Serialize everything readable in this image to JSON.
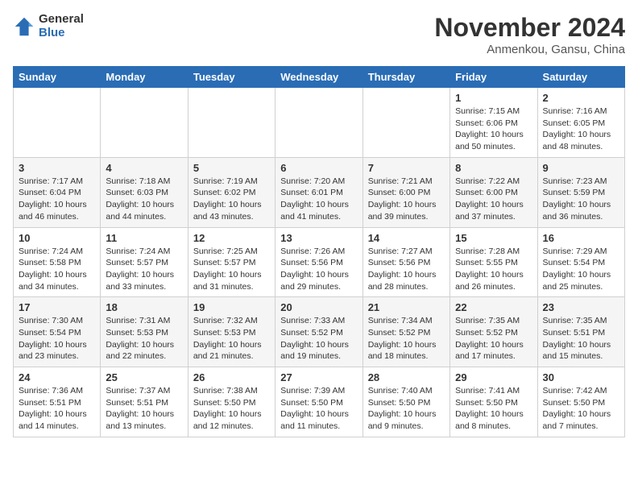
{
  "header": {
    "logo": {
      "general": "General",
      "blue": "Blue"
    },
    "title": "November 2024",
    "location": "Anmenkou, Gansu, China"
  },
  "days_of_week": [
    "Sunday",
    "Monday",
    "Tuesday",
    "Wednesday",
    "Thursday",
    "Friday",
    "Saturday"
  ],
  "weeks": [
    [
      {
        "day": "",
        "info": ""
      },
      {
        "day": "",
        "info": ""
      },
      {
        "day": "",
        "info": ""
      },
      {
        "day": "",
        "info": ""
      },
      {
        "day": "",
        "info": ""
      },
      {
        "day": "1",
        "info": "Sunrise: 7:15 AM\nSunset: 6:06 PM\nDaylight: 10 hours\nand 50 minutes."
      },
      {
        "day": "2",
        "info": "Sunrise: 7:16 AM\nSunset: 6:05 PM\nDaylight: 10 hours\nand 48 minutes."
      }
    ],
    [
      {
        "day": "3",
        "info": "Sunrise: 7:17 AM\nSunset: 6:04 PM\nDaylight: 10 hours\nand 46 minutes."
      },
      {
        "day": "4",
        "info": "Sunrise: 7:18 AM\nSunset: 6:03 PM\nDaylight: 10 hours\nand 44 minutes."
      },
      {
        "day": "5",
        "info": "Sunrise: 7:19 AM\nSunset: 6:02 PM\nDaylight: 10 hours\nand 43 minutes."
      },
      {
        "day": "6",
        "info": "Sunrise: 7:20 AM\nSunset: 6:01 PM\nDaylight: 10 hours\nand 41 minutes."
      },
      {
        "day": "7",
        "info": "Sunrise: 7:21 AM\nSunset: 6:00 PM\nDaylight: 10 hours\nand 39 minutes."
      },
      {
        "day": "8",
        "info": "Sunrise: 7:22 AM\nSunset: 6:00 PM\nDaylight: 10 hours\nand 37 minutes."
      },
      {
        "day": "9",
        "info": "Sunrise: 7:23 AM\nSunset: 5:59 PM\nDaylight: 10 hours\nand 36 minutes."
      }
    ],
    [
      {
        "day": "10",
        "info": "Sunrise: 7:24 AM\nSunset: 5:58 PM\nDaylight: 10 hours\nand 34 minutes."
      },
      {
        "day": "11",
        "info": "Sunrise: 7:24 AM\nSunset: 5:57 PM\nDaylight: 10 hours\nand 33 minutes."
      },
      {
        "day": "12",
        "info": "Sunrise: 7:25 AM\nSunset: 5:57 PM\nDaylight: 10 hours\nand 31 minutes."
      },
      {
        "day": "13",
        "info": "Sunrise: 7:26 AM\nSunset: 5:56 PM\nDaylight: 10 hours\nand 29 minutes."
      },
      {
        "day": "14",
        "info": "Sunrise: 7:27 AM\nSunset: 5:56 PM\nDaylight: 10 hours\nand 28 minutes."
      },
      {
        "day": "15",
        "info": "Sunrise: 7:28 AM\nSunset: 5:55 PM\nDaylight: 10 hours\nand 26 minutes."
      },
      {
        "day": "16",
        "info": "Sunrise: 7:29 AM\nSunset: 5:54 PM\nDaylight: 10 hours\nand 25 minutes."
      }
    ],
    [
      {
        "day": "17",
        "info": "Sunrise: 7:30 AM\nSunset: 5:54 PM\nDaylight: 10 hours\nand 23 minutes."
      },
      {
        "day": "18",
        "info": "Sunrise: 7:31 AM\nSunset: 5:53 PM\nDaylight: 10 hours\nand 22 minutes."
      },
      {
        "day": "19",
        "info": "Sunrise: 7:32 AM\nSunset: 5:53 PM\nDaylight: 10 hours\nand 21 minutes."
      },
      {
        "day": "20",
        "info": "Sunrise: 7:33 AM\nSunset: 5:52 PM\nDaylight: 10 hours\nand 19 minutes."
      },
      {
        "day": "21",
        "info": "Sunrise: 7:34 AM\nSunset: 5:52 PM\nDaylight: 10 hours\nand 18 minutes."
      },
      {
        "day": "22",
        "info": "Sunrise: 7:35 AM\nSunset: 5:52 PM\nDaylight: 10 hours\nand 17 minutes."
      },
      {
        "day": "23",
        "info": "Sunrise: 7:35 AM\nSunset: 5:51 PM\nDaylight: 10 hours\nand 15 minutes."
      }
    ],
    [
      {
        "day": "24",
        "info": "Sunrise: 7:36 AM\nSunset: 5:51 PM\nDaylight: 10 hours\nand 14 minutes."
      },
      {
        "day": "25",
        "info": "Sunrise: 7:37 AM\nSunset: 5:51 PM\nDaylight: 10 hours\nand 13 minutes."
      },
      {
        "day": "26",
        "info": "Sunrise: 7:38 AM\nSunset: 5:50 PM\nDaylight: 10 hours\nand 12 minutes."
      },
      {
        "day": "27",
        "info": "Sunrise: 7:39 AM\nSunset: 5:50 PM\nDaylight: 10 hours\nand 11 minutes."
      },
      {
        "day": "28",
        "info": "Sunrise: 7:40 AM\nSunset: 5:50 PM\nDaylight: 10 hours\nand 9 minutes."
      },
      {
        "day": "29",
        "info": "Sunrise: 7:41 AM\nSunset: 5:50 PM\nDaylight: 10 hours\nand 8 minutes."
      },
      {
        "day": "30",
        "info": "Sunrise: 7:42 AM\nSunset: 5:50 PM\nDaylight: 10 hours\nand 7 minutes."
      }
    ]
  ]
}
